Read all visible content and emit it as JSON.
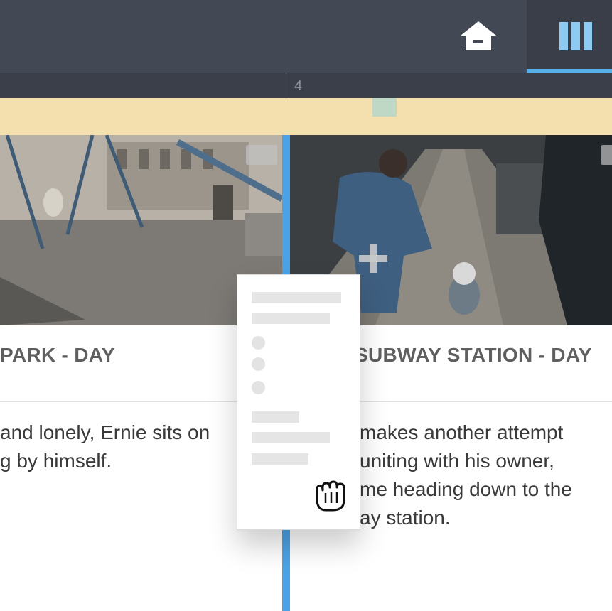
{
  "toolbar": {
    "home_icon": "home-icon",
    "columns_icon": "columns-icon"
  },
  "ruler": {
    "marker": "4"
  },
  "scenes": [
    {
      "title": "PARK - DAY",
      "lines": [
        "and lonely, Ernie sits on",
        "g by himself."
      ]
    },
    {
      "title": "SUBWAY STATION - DAY",
      "lines": [
        "makes another attempt",
        "uniting with his owner,",
        "me heading down to the",
        "ay station."
      ]
    }
  ],
  "add_icon": "plus-icon",
  "drag_icon": "grab-hand-icon",
  "colors": {
    "accent": "#4aa3e6",
    "topbar": "#434954",
    "band": "#f4e0af"
  }
}
